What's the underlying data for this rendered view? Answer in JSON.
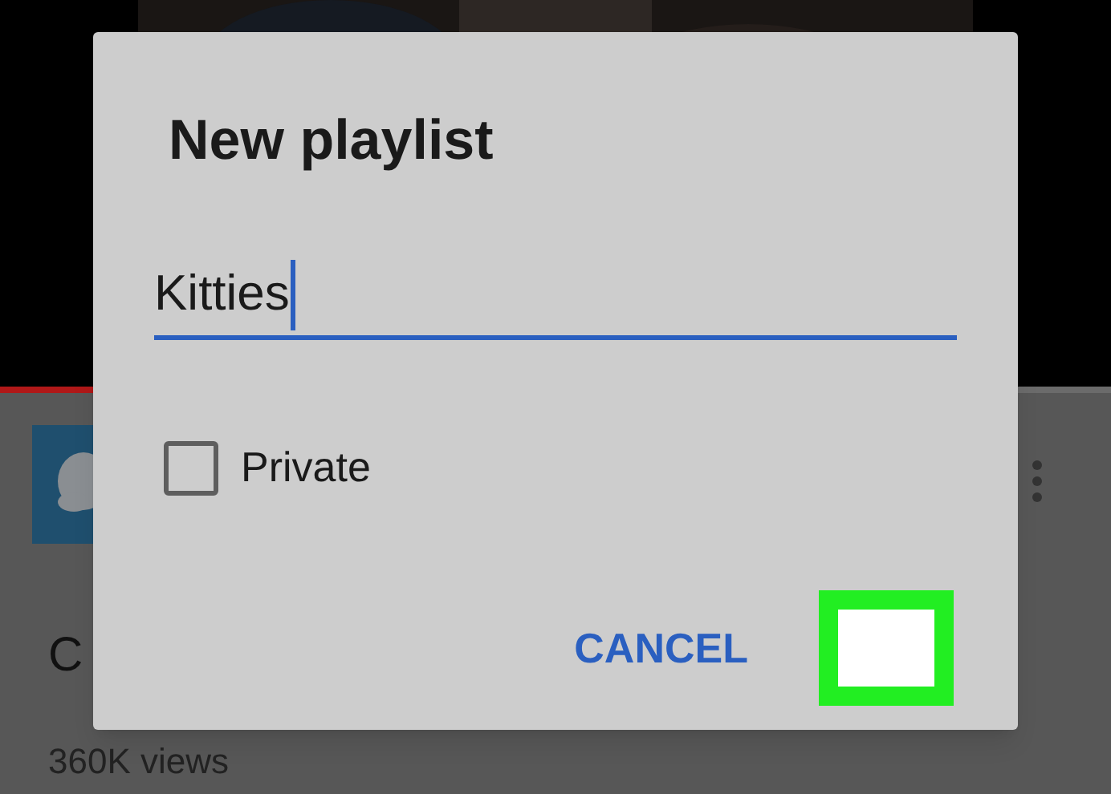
{
  "background": {
    "video": {
      "progress": {
        "level": 0.5
      }
    },
    "video_title": "C",
    "views": "360K views"
  },
  "dialog": {
    "title": "New playlist",
    "name_field": {
      "value": "Kitties",
      "focused": true
    },
    "private": {
      "label": "Private",
      "checked": false
    },
    "buttons": [
      {
        "label": "CANCEL",
        "highlighted": false
      },
      {
        "highlighted": true
      }
    ]
  }
}
